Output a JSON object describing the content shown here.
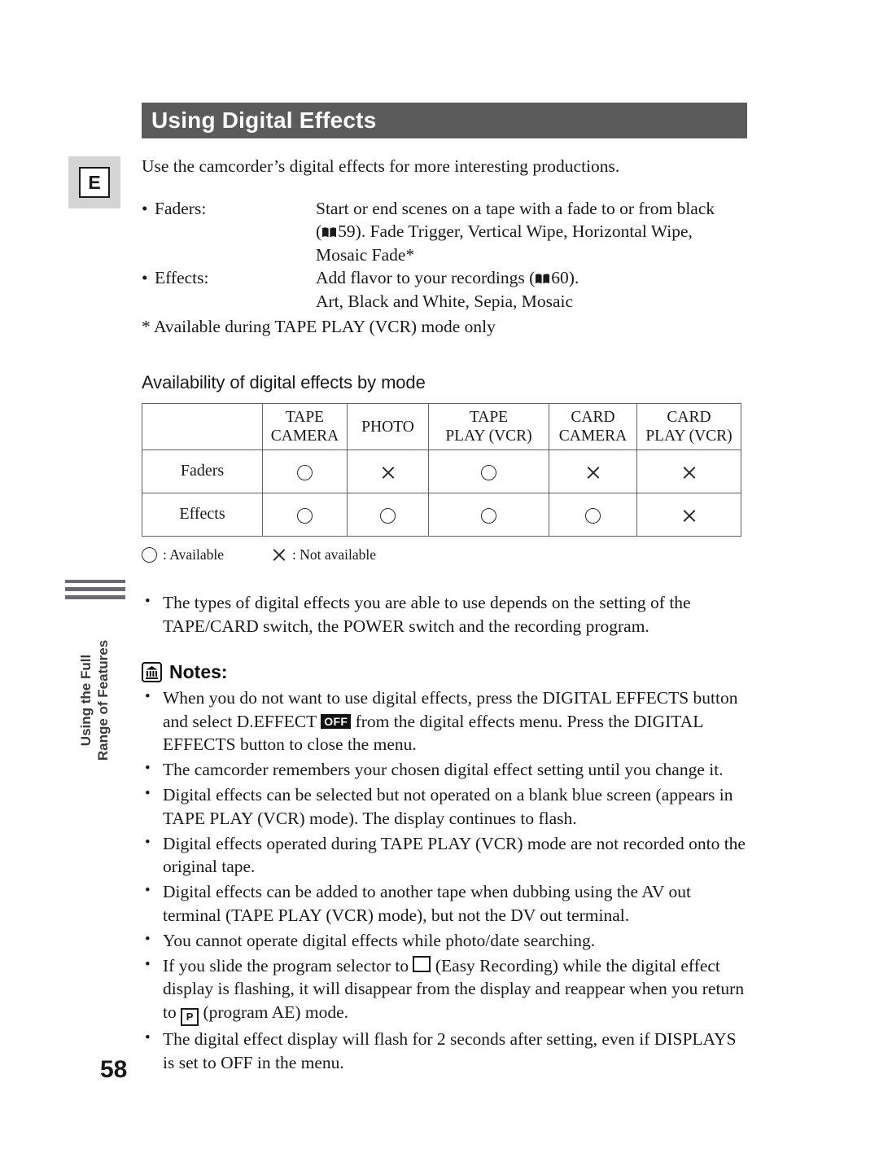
{
  "page": {
    "number": "58",
    "language_badge": "E",
    "side_tab": "Using the Full\nRange of Features"
  },
  "header": {
    "title": "Using Digital Effects"
  },
  "intro": "Use the camcorder’s digital effects for more interesting productions.",
  "definitions": [
    {
      "term": "Faders:",
      "desc_line1": "Start or end scenes on a tape with a fade to or from black",
      "desc_line2_pre": "(",
      "desc_line2_page": "59",
      "desc_line2_post": "). Fade Trigger, Vertical Wipe, Horizontal Wipe,",
      "desc_line3": "Mosaic Fade*"
    },
    {
      "term": "Effects:",
      "desc_line1_pre": "Add flavor to your recordings (",
      "desc_line1_page": "60",
      "desc_line1_post": ").",
      "desc_line2": "Art, Black and White, Sepia, Mosaic"
    }
  ],
  "footnote": "* Available during TAPE PLAY (VCR) mode only",
  "table": {
    "subheading": "Availability of digital effects by mode",
    "headers": [
      "",
      "TAPE\nCAMERA",
      "PHOTO",
      "TAPE\nPLAY (VCR)",
      "CARD\nCAMERA",
      "CARD\nPLAY (VCR)"
    ],
    "rows": [
      {
        "label": "Faders",
        "cells": [
          "available",
          "not-available",
          "available",
          "not-available",
          "not-available"
        ]
      },
      {
        "label": "Effects",
        "cells": [
          "available",
          "available",
          "available",
          "available",
          "not-available"
        ]
      }
    ],
    "legend": {
      "available_label": ": Available",
      "not_available_label": ": Not available"
    }
  },
  "pre_notes_bullets": [
    "The types of digital effects you are able to use depends on the setting of the TAPE/CARD switch, the POWER switch and the recording program."
  ],
  "notes": {
    "heading": "Notes:",
    "items": [
      {
        "parts": [
          {
            "type": "text",
            "value": "When you do not want to use digital effects, press the DIGITAL EFFECTS button and select D.EFFECT "
          },
          {
            "type": "badge",
            "value": "OFF"
          },
          {
            "type": "text",
            "value": " from the digital effects menu. Press the DIGITAL EFFECTS button to close the menu."
          }
        ]
      },
      {
        "parts": [
          {
            "type": "text",
            "value": "The camcorder remembers your chosen digital effect setting until you change it."
          }
        ]
      },
      {
        "parts": [
          {
            "type": "text",
            "value": "Digital effects can be selected but not operated on a blank blue screen (appears in TAPE PLAY (VCR) mode). The display continues to flash."
          }
        ]
      },
      {
        "parts": [
          {
            "type": "text",
            "value": "Digital effects operated during TAPE PLAY (VCR) mode are not recorded onto the original tape."
          }
        ]
      },
      {
        "parts": [
          {
            "type": "text",
            "value": "Digital effects can be added to another tape when dubbing using the AV out terminal (TAPE PLAY (VCR) mode), but not the DV out terminal."
          }
        ]
      },
      {
        "parts": [
          {
            "type": "text",
            "value": "You cannot operate digital effects while photo/date searching."
          }
        ]
      },
      {
        "parts": [
          {
            "type": "text",
            "value": "If you slide the program selector to "
          },
          {
            "type": "square-icon",
            "value": ""
          },
          {
            "type": "text",
            "value": " (Easy Recording) while the digital effect display is flashing, it will disappear from the display and reappear when you return to "
          },
          {
            "type": "p-icon",
            "value": "P"
          },
          {
            "type": "text",
            "value": " (program AE) mode."
          }
        ]
      },
      {
        "parts": [
          {
            "type": "text",
            "value": "The digital effect display will flash for 2 seconds after setting, even if DISPLAYS is set to OFF in the menu."
          }
        ]
      }
    ]
  },
  "colors": {
    "title_bar": "#5b5b5b",
    "badge_box": "#d4d4d4",
    "table_border": "#6b5f5f",
    "side_rule": "#6b6b75"
  }
}
